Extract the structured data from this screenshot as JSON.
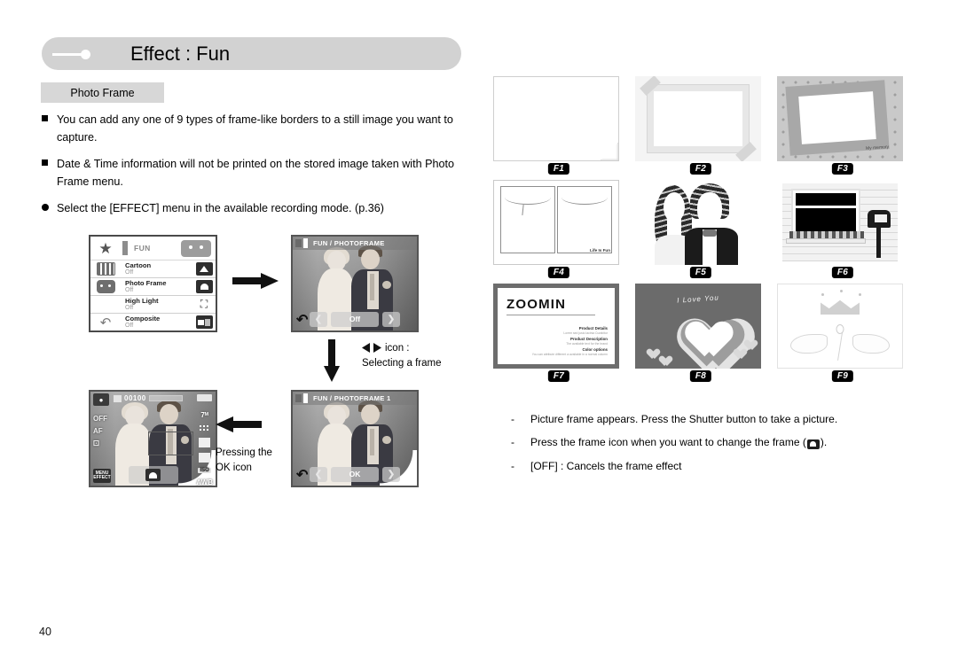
{
  "header": {
    "title": "Effect : Fun"
  },
  "section": {
    "label": "Photo Frame"
  },
  "bullets": [
    {
      "marker": "square",
      "text": "You can add any one of 9 types of frame-like borders to a still image you want to capture."
    },
    {
      "marker": "square",
      "text": "Date & Time information will not be printed on the stored image taken with Photo Frame menu."
    },
    {
      "marker": "circle",
      "text": "Select the [EFFECT] menu in the available recording mode. (p.36)"
    }
  ],
  "camera_menu_screen": {
    "title": "FUN",
    "rows": [
      {
        "label": "Cartoon",
        "value": "Off",
        "icon": "cartoon-icon"
      },
      {
        "label": "Photo Frame",
        "value": "Off",
        "icon": "photo-frame-icon"
      },
      {
        "label": "High Light",
        "value": "Off",
        "icon": "high-light-icon"
      },
      {
        "label": "Composite",
        "value": "Off",
        "icon": "composite-icon"
      }
    ],
    "side_icons": [
      "star-icon",
      "film-icon",
      "face-icon",
      "return-icon"
    ]
  },
  "frame_off_screen": {
    "title": "FUN / PHOTOFRAME",
    "left_arrow": "❮",
    "center_label": "Off",
    "right_arrow": "❯",
    "return_icon": "return-icon"
  },
  "frame_one_screen": {
    "title": "FUN / PHOTOFRAME 1",
    "left_arrow": "❮",
    "center_label": "OK",
    "right_arrow": "❯",
    "return_icon": "return-icon"
  },
  "live_view_screen": {
    "counter": "00100",
    "resolution": "7ᴹ",
    "self_timer": "OFF",
    "focus_mode": "AF",
    "iso": "ISO",
    "iso_value": "AUTO",
    "white_balance": "AWB",
    "menu_button_line1": "MENU",
    "menu_button_line2": "EFFECT",
    "frame_icon": "photo-frame-icon"
  },
  "annotations": {
    "arrow_right": "arrow-right-icon",
    "arrow_down": "arrow-down-icon",
    "arrow_left": "arrow-left-icon",
    "select_frame_icon": "left-right-arrow-icon",
    "select_frame_line1": "icon :",
    "select_frame_line2": "Selecting a frame",
    "press_ok_line1": "Pressing the",
    "press_ok_line2": "OK icon"
  },
  "frames": [
    {
      "id": "F1",
      "name": "folded-page-frame"
    },
    {
      "id": "F2",
      "name": "taped-mat-frame"
    },
    {
      "id": "F3",
      "name": "star-pattern-frame",
      "caption": "My memory"
    },
    {
      "id": "F4",
      "name": "comic-panel-frame",
      "caption": "Life Is Fun"
    },
    {
      "id": "F5",
      "name": "couple-cutout-frame"
    },
    {
      "id": "F6",
      "name": "house-window-frame"
    },
    {
      "id": "F7",
      "name": "zoomin-card-frame",
      "title": "ZOOMIN",
      "lines": [
        {
          "head": "Product Details",
          "sub": "Lorem sed justo lacinia Curabitur"
        },
        {
          "head": "Product Description",
          "sub": "The available text for the brand"
        },
        {
          "head": "Color options",
          "sub": "You can attribute different a available in a normal column"
        }
      ]
    },
    {
      "id": "F8",
      "name": "heart-frame",
      "caption": "I Love You"
    },
    {
      "id": "F9",
      "name": "angel-wings-frame"
    }
  ],
  "notes": [
    {
      "marker": "-",
      "text": "Picture frame appears. Press the Shutter button to take a picture."
    },
    {
      "marker": "-",
      "text_before": "Press the frame icon when you want to change the frame (",
      "icon": "photo-frame-icon",
      "text_after": ")."
    },
    {
      "marker": "-",
      "text": "[OFF] : Cancels the frame effect"
    }
  ],
  "page_number": "40"
}
